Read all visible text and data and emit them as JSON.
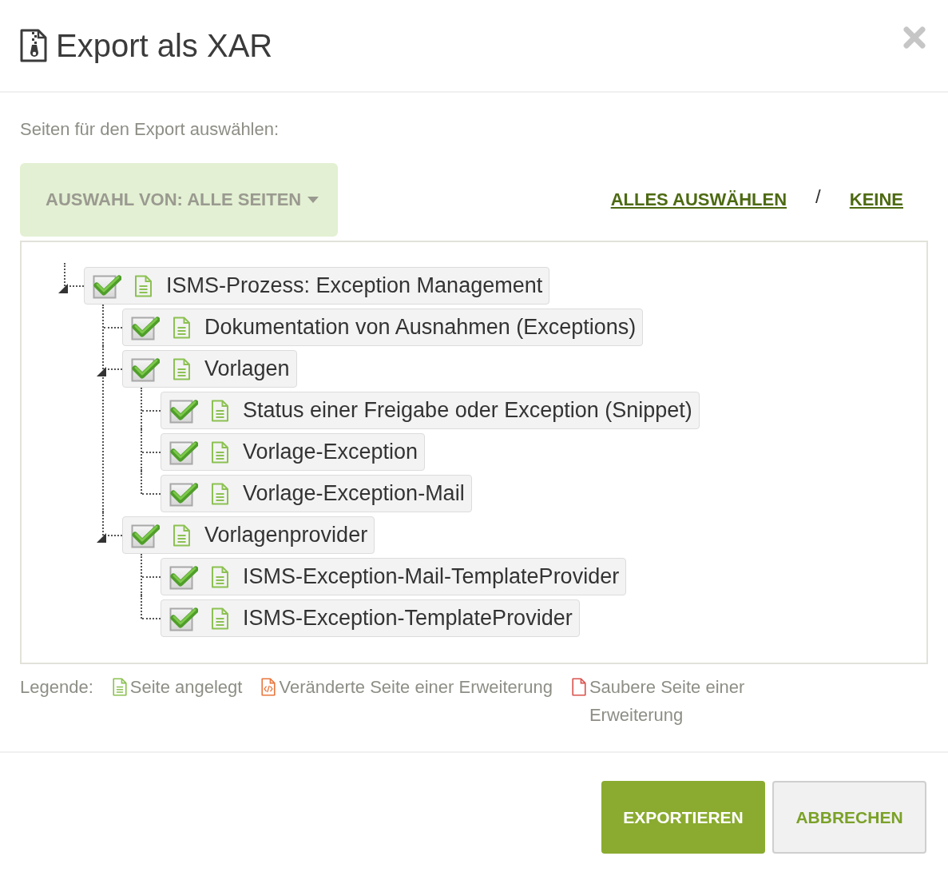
{
  "dialog": {
    "title": "Export als XAR"
  },
  "instruction": "Seiten für den Export auswählen:",
  "selection_dropdown": {
    "label": "AUSWAHL VON: ALLE SEITEN"
  },
  "select_links": {
    "all": "ALLES AUSWÄHLEN",
    "separator": "/",
    "none": "KEINE"
  },
  "tree": [
    {
      "title": "ISMS-Prozess: Exception Management",
      "kind": "created",
      "checked": true,
      "expanded": true,
      "children": [
        {
          "title": "Dokumentation von Ausnahmen (Exceptions)",
          "kind": "created",
          "checked": true
        },
        {
          "title": "Vorlagen",
          "kind": "created",
          "checked": true,
          "expanded": true,
          "children": [
            {
              "title": "Status einer Freigabe oder Exception (Snippet)",
              "kind": "created",
              "checked": true
            },
            {
              "title": "Vorlage-Exception",
              "kind": "created",
              "checked": true
            },
            {
              "title": "Vorlage-Exception-Mail",
              "kind": "created",
              "checked": true
            }
          ]
        },
        {
          "title": "Vorlagenprovider",
          "kind": "created",
          "checked": true,
          "expanded": true,
          "children": [
            {
              "title": "ISMS-Exception-Mail-TemplateProvider",
              "kind": "created",
              "checked": true
            },
            {
              "title": "ISMS-Exception-TemplateProvider",
              "kind": "created",
              "checked": true
            }
          ]
        }
      ]
    }
  ],
  "legend": {
    "label": "Legende:",
    "items": [
      {
        "kind": "created",
        "text": "Seite angelegt"
      },
      {
        "kind": "modified",
        "text": "Veränderte Seite einer Erweiterung"
      },
      {
        "kind": "clean",
        "text": "Saubere Seite einer Erweiterung"
      }
    ]
  },
  "buttons": [
    {
      "label": "EXPORTIEREN",
      "kind": "primary"
    },
    {
      "label": "ABBRECHEN",
      "kind": "secondary"
    }
  ]
}
